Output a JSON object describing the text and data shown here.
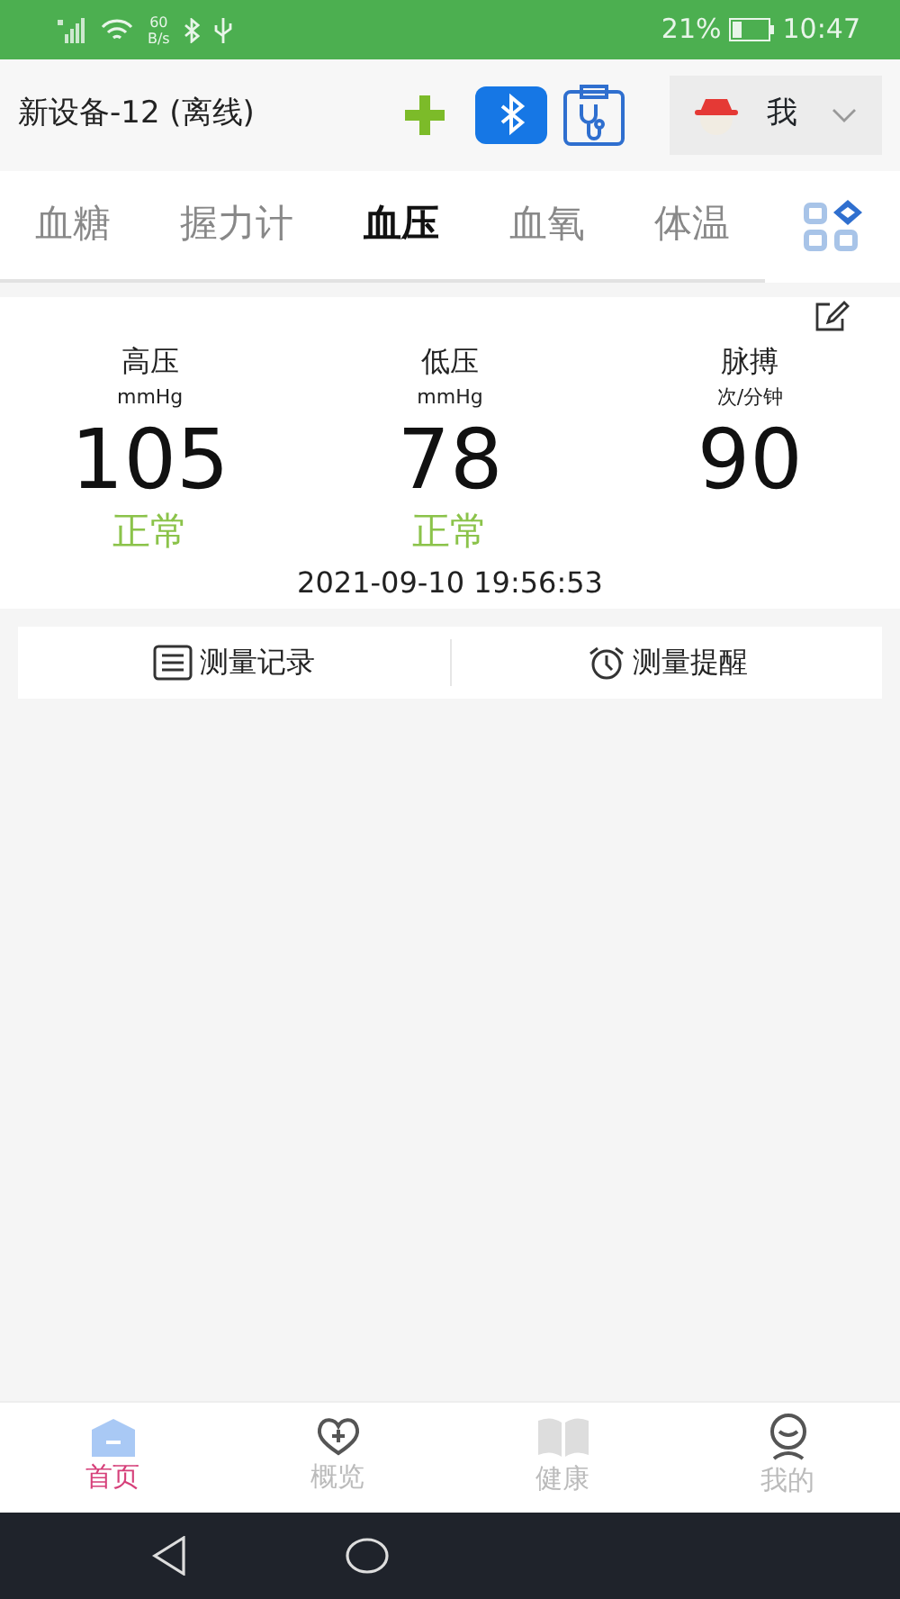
{
  "status_bar": {
    "speed": "60",
    "speed_unit": "B/s",
    "battery": "21%",
    "time": "10:47"
  },
  "header": {
    "device": "新设备-12 (离线)",
    "user": "我"
  },
  "tabs": [
    {
      "label": "血糖",
      "selected": false
    },
    {
      "label": "握力计",
      "selected": false
    },
    {
      "label": "血压",
      "selected": true
    },
    {
      "label": "血氧",
      "selected": false
    },
    {
      "label": "体温",
      "selected": false
    }
  ],
  "readings": [
    {
      "name": "高压",
      "unit": "mmHg",
      "value": "105",
      "status": "正常"
    },
    {
      "name": "低压",
      "unit": "mmHg",
      "value": "78",
      "status": "正常"
    },
    {
      "name": "脉搏",
      "unit": "次/分钟",
      "value": "90"
    }
  ],
  "timestamp": "2021-09-10 19:56:53",
  "actions": [
    {
      "kind": "records",
      "label": "测量记录"
    },
    {
      "kind": "reminder",
      "label": "测量提醒"
    }
  ],
  "bottom_nav": [
    {
      "kind": "home",
      "label": "首页",
      "selected": true
    },
    {
      "kind": "overview",
      "label": "概览",
      "selected": false
    },
    {
      "kind": "health",
      "label": "健康",
      "selected": false
    },
    {
      "kind": "me",
      "label": "我的",
      "selected": false
    }
  ]
}
